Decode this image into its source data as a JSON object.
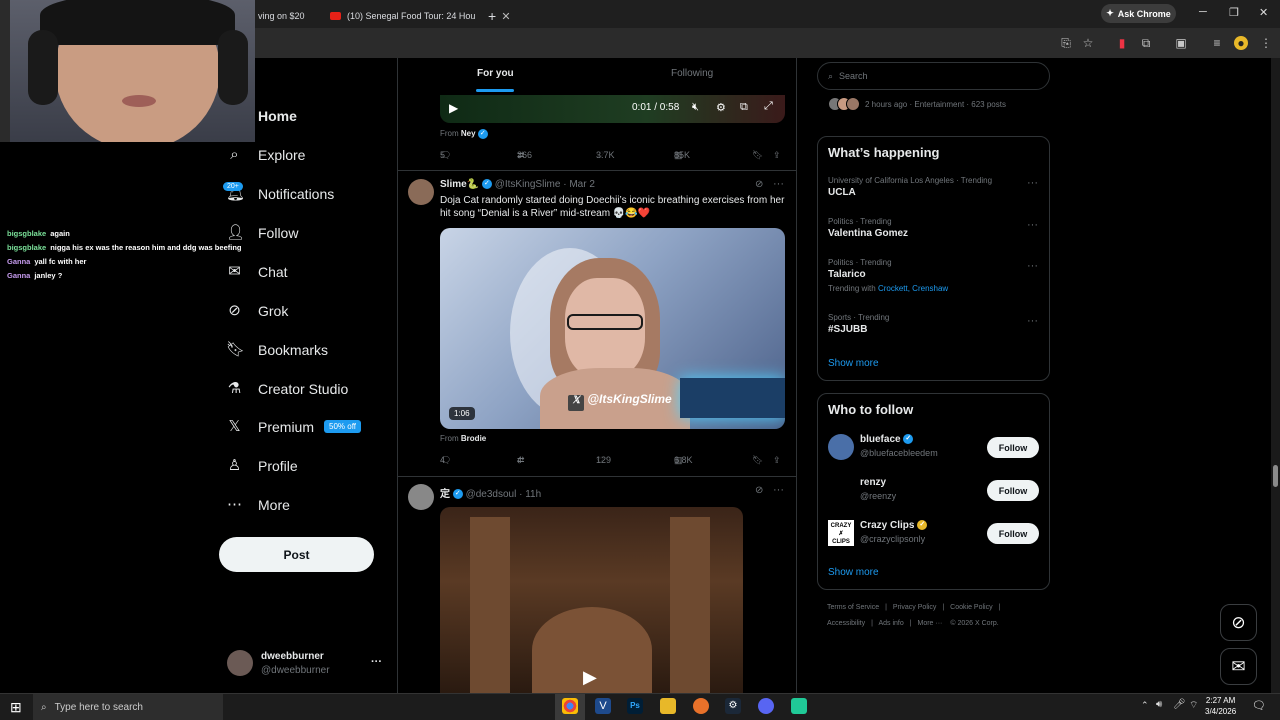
{
  "browser": {
    "tabs": [
      {
        "label": "ving on $20"
      },
      {
        "label": "(10) Senegal Food Tour: 24 Hou"
      }
    ],
    "ask_chrome": "Ask Chrome"
  },
  "chat": [
    {
      "user": "bigsgblake",
      "msg": "again"
    },
    {
      "user": "bigsgblake",
      "msg": "nigga his ex was the reason him and ddg was beefing"
    },
    {
      "user": "Ganna",
      "msg": "yall fc with her"
    },
    {
      "user": "Ganna",
      "msg": "janley ?"
    }
  ],
  "nav": {
    "items": [
      {
        "label": "Home",
        "icon": "home-icon"
      },
      {
        "label": "Explore",
        "icon": "search-icon"
      },
      {
        "label": "Notifications",
        "icon": "bell-icon"
      },
      {
        "label": "Follow",
        "icon": "person-plus-icon"
      },
      {
        "label": "Chat",
        "icon": "mail-icon"
      },
      {
        "label": "Grok",
        "icon": "grok-icon"
      },
      {
        "label": "Bookmarks",
        "icon": "bookmark-icon"
      },
      {
        "label": "Creator Studio",
        "icon": "flask-icon"
      },
      {
        "label": "Premium",
        "icon": "x-logo-icon"
      },
      {
        "label": "Profile",
        "icon": "person-icon"
      },
      {
        "label": "More",
        "icon": "more-circle-icon"
      }
    ],
    "notif_badge": "20+",
    "premium_badge": "50% off",
    "post_label": "Post"
  },
  "account": {
    "name": "dweebburner",
    "handle": "@dweebburner",
    "more": "···"
  },
  "feed": {
    "tabs": {
      "for_you": "For you",
      "following": "Following"
    },
    "tweet0": {
      "video_time": "0:01 / 0:58",
      "from_prefix": "From",
      "from_name": "Ney",
      "replies": "5",
      "retweets": "366",
      "likes": "3.7K",
      "views": "85K"
    },
    "tweet1": {
      "name": "Slime🐍",
      "handle": "@ItsKingSlime",
      "date": "· Mar 2",
      "text": "Doja Cat randomly started doing Doechii’s iconic breathing exercises from her hit song “Denial is a River” mid-stream 💀😂❤️",
      "watermark": "@ItsKingSlime",
      "duration": "1:06",
      "from_prefix": "From",
      "from_name": "Brodie",
      "replies": "4",
      "retweets": "4",
      "likes": "129",
      "views": "6.8K"
    },
    "tweet2": {
      "name": "定",
      "handle": "@de3dsoul",
      "date": "· 11h"
    }
  },
  "sidebar": {
    "search_placeholder": "Search",
    "top_meta": "2 hours ago · Entertainment · 623 posts",
    "happening_title": "What’s happening",
    "trends": [
      {
        "cat": "University of California Los Angeles · Trending",
        "name": "UCLA"
      },
      {
        "cat": "Politics · Trending",
        "name": "Valentina Gomez"
      },
      {
        "cat": "Politics · Trending",
        "name": "Talarico",
        "extra_prefix": "Trending with ",
        "extra_links": "Crockett, Crenshaw"
      },
      {
        "cat": "Sports · Trending",
        "name": "#SJUBB"
      }
    ],
    "show_more": "Show more",
    "who_title": "Who to follow",
    "who": [
      {
        "name": "blueface",
        "handle": "@bluefacebleedem",
        "btn": "Follow"
      },
      {
        "name": "renzy",
        "handle": "@reenzy",
        "btn": "Follow"
      },
      {
        "name": "Crazy Clips",
        "handle": "@crazyclipsonly",
        "btn": "Follow"
      }
    ],
    "footer": [
      "Terms of Service",
      "|",
      "Privacy Policy",
      "|",
      "Cookie Policy",
      "|",
      "Accessibility",
      "|",
      "Ads info",
      "|",
      "More ···",
      "© 2026 X Corp."
    ]
  },
  "taskbar": {
    "search": "Type here to search",
    "time": "2:27 AM",
    "date": "3/4/2026"
  }
}
